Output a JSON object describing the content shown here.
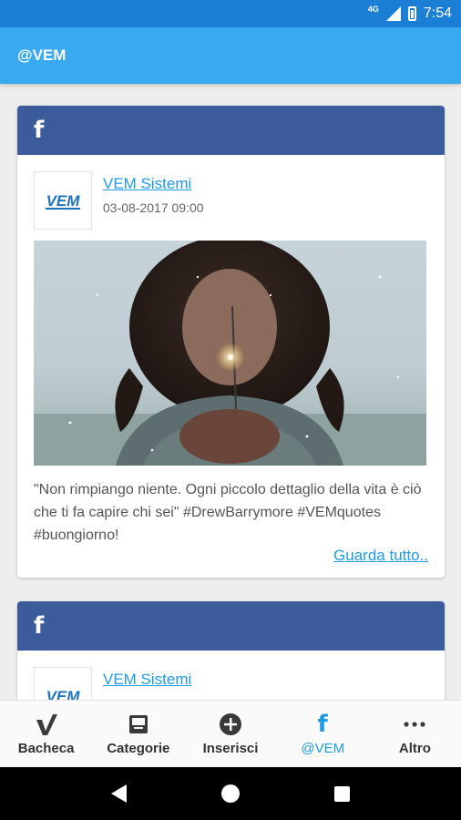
{
  "status_bar": {
    "network": "4G",
    "time": "7:54"
  },
  "app_bar": {
    "title": "@VEM"
  },
  "posts": [
    {
      "source_icon": "facebook-icon",
      "author": "VEM Sistemi",
      "date": "03-08-2017 09:00",
      "logo_text": "VEM",
      "text": "\"Non rimpiango niente. Ogni piccolo dettaglio della vita è ciò che ti fa capire chi sei\" #DrewBarrymore #VEMquotes #buongiorno!",
      "more_label": "Guarda tutto.."
    },
    {
      "source_icon": "facebook-icon",
      "author": "VEM Sistemi",
      "logo_text": "VEM"
    }
  ],
  "bottom_nav": {
    "items": [
      {
        "label": "Bacheca",
        "icon": "checkmark-icon"
      },
      {
        "label": "Categorie",
        "icon": "inbox-icon"
      },
      {
        "label": "Inserisci",
        "icon": "add-circle-icon"
      },
      {
        "label": "@VEM",
        "icon": "facebook-icon"
      },
      {
        "label": "Altro",
        "icon": "more-horizontal-icon"
      }
    ],
    "active_index": 3,
    "active_color": "#1e9be8"
  },
  "colors": {
    "status_bar": "#1c7fd6",
    "app_bar": "#39a9f1",
    "facebook_header": "#3b5b9a",
    "link": "#1e9be8"
  }
}
